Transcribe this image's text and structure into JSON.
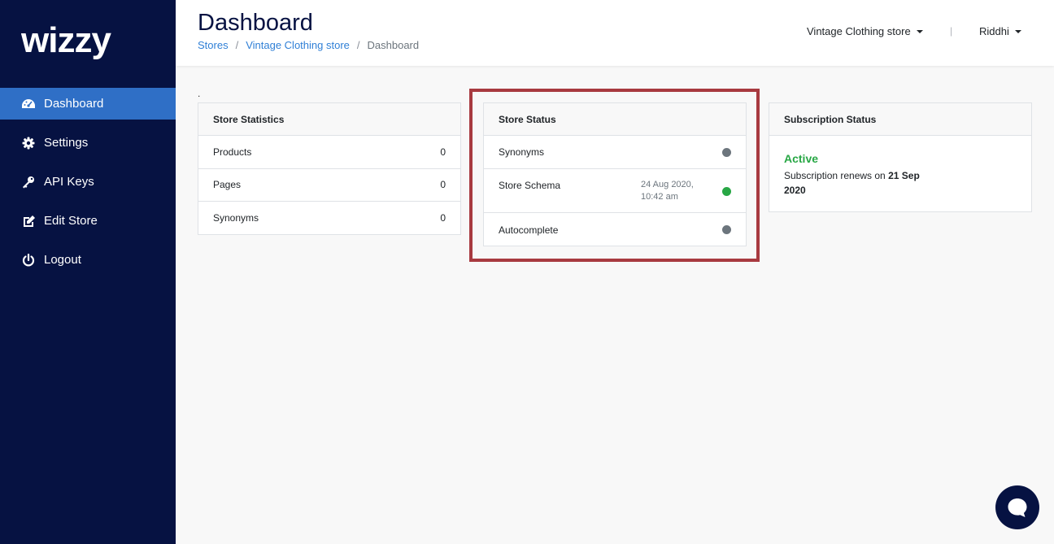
{
  "brand": {
    "name": "wizzy"
  },
  "sidebar": {
    "items": [
      {
        "label": "Dashboard",
        "icon": "dashboard-gauge-icon",
        "active": true
      },
      {
        "label": "Settings",
        "icon": "gear-icon",
        "active": false
      },
      {
        "label": "API Keys",
        "icon": "key-icon",
        "active": false
      },
      {
        "label": "Edit Store",
        "icon": "edit-icon",
        "active": false
      },
      {
        "label": "Logout",
        "icon": "power-icon",
        "active": false
      }
    ]
  },
  "header": {
    "title": "Dashboard",
    "breadcrumb": [
      "Stores",
      "Vintage Clothing store",
      "Dashboard"
    ],
    "breadcrumb_sep": "/",
    "store_selector": "Vintage Clothing store",
    "divider": "|",
    "user": "Riddhi"
  },
  "misc": {
    "dot": "."
  },
  "store_statistics": {
    "title": "Store Statistics",
    "rows": [
      {
        "label": "Products",
        "value": "0"
      },
      {
        "label": "Pages",
        "value": "0"
      },
      {
        "label": "Synonyms",
        "value": "0"
      }
    ]
  },
  "store_status": {
    "title": "Store Status",
    "rows": [
      {
        "label": "Synonyms",
        "date_line1": "",
        "date_line2": "",
        "status_color": "#6c757d"
      },
      {
        "label": "Store Schema",
        "date_line1": "24 Aug 2020,",
        "date_line2": "10:42 am",
        "status_color": "#28a745"
      },
      {
        "label": "Autocomplete",
        "date_line1": "",
        "date_line2": "",
        "status_color": "#6c757d"
      }
    ]
  },
  "subscription_status": {
    "title": "Subscription Status",
    "state": "Active",
    "renews_prefix": "Subscription renews on ",
    "renews_date": "21 Sep 2020"
  },
  "colors": {
    "sidebar_bg": "#061242",
    "active_nav": "#2f6fc6",
    "link": "#2f7fd6",
    "success": "#28a745",
    "inactive_dot": "#6c757d",
    "highlight_border": "#a83a40"
  }
}
